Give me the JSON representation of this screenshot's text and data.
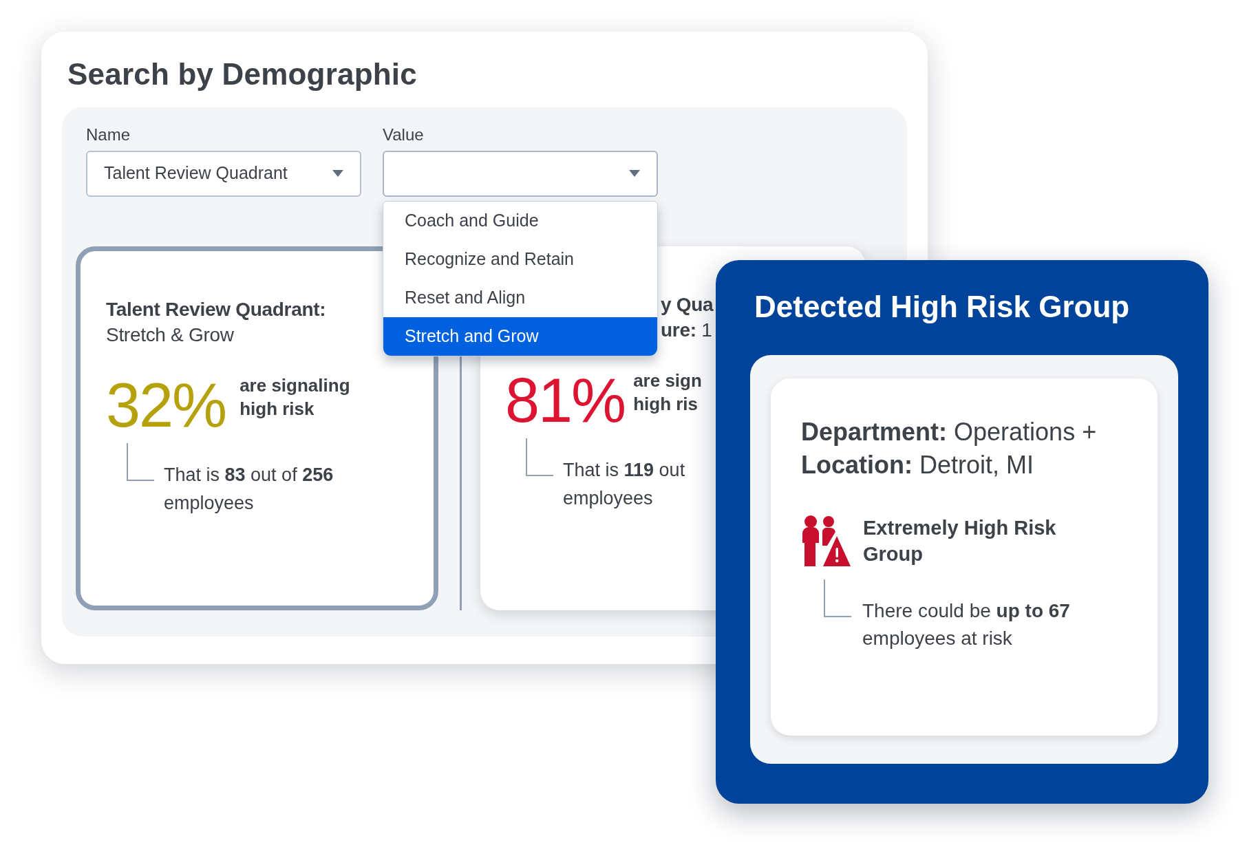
{
  "search_panel": {
    "title": "Search by Demographic",
    "fields": [
      {
        "label": "Name",
        "value": "Talent Review Quadrant",
        "expanded": false
      },
      {
        "label": "Value",
        "expanded": true
      }
    ],
    "dropdown": {
      "options": [
        {
          "label": "Coach and Guide",
          "selected": false
        },
        {
          "label": "Recognize and Retain",
          "selected": false
        },
        {
          "label": "Reset and Align",
          "selected": false
        },
        {
          "label": "Stretch and Grow",
          "selected": true
        }
      ]
    },
    "cards": [
      {
        "selected": true,
        "color": "#b5a10c",
        "title": [
          "**Talent Review Quadrant:**",
          "Stretch & Grow"
        ],
        "percent": "32%",
        "signal": [
          "are signaling",
          "high risk"
        ],
        "detail": [
          "That is **83** out of **256**",
          "employees"
        ]
      },
      {
        "selected": false,
        "color": "#dc1431",
        "title": [
          "**y Qua**",
          "**ure:** 1"
        ],
        "percent": "81%",
        "signal": [
          "are sign",
          "high ris"
        ],
        "detail": [
          "That is **119** out",
          "employees"
        ]
      }
    ]
  },
  "risk_panel": {
    "title": "Detected High Risk Group",
    "criteria": "**Department:** Operations + **Location:** Detroit, MI",
    "group": "Extremely High Risk Group",
    "detail": "There could be **up to 67** employees at risk"
  }
}
